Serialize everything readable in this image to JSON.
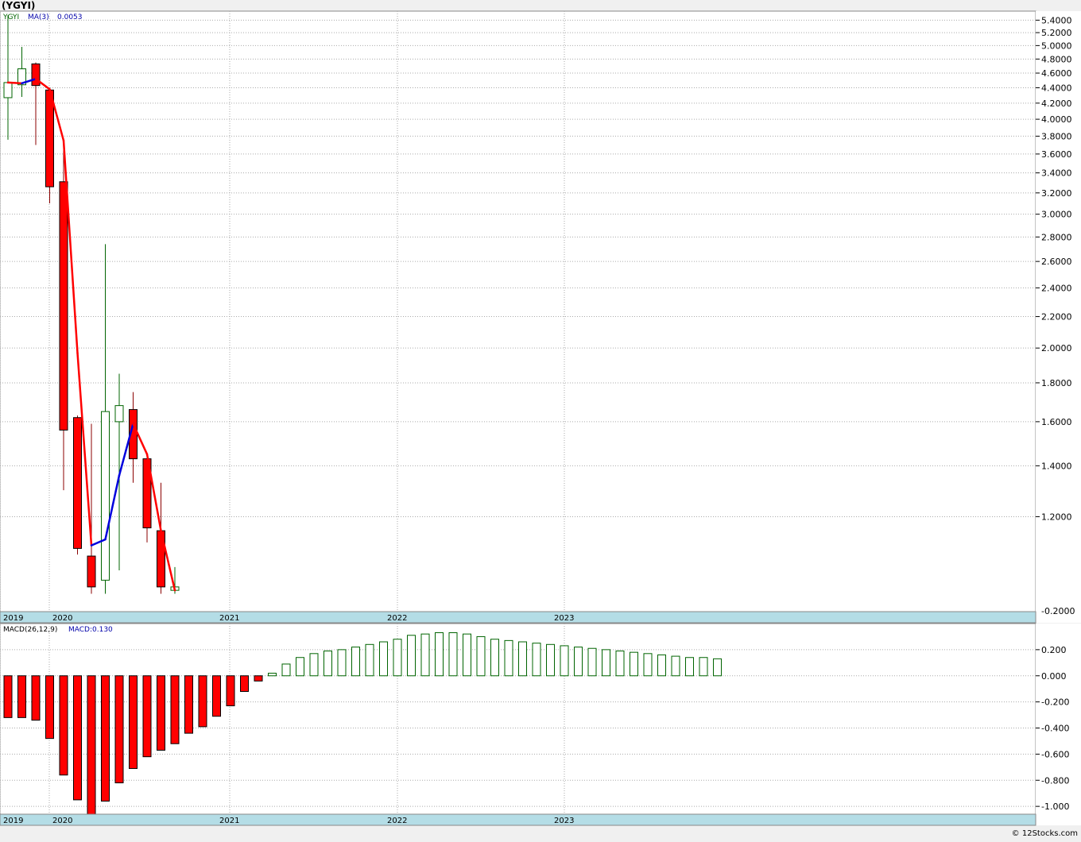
{
  "chart_data": [
    {
      "type": "candlestick",
      "title": "(YGYI)",
      "legend": {
        "symbol": "YGYI",
        "ma_label": "MA(3)",
        "last_value": "0.0053",
        "placement": "top-left"
      },
      "scale": "log",
      "ylim": [
        0.9,
        5.55
      ],
      "y_ticks": [
        "5.4000",
        "5.2000",
        "5.0000",
        "4.8000",
        "4.6000",
        "4.4000",
        "4.2000",
        "4.0000",
        "3.8000",
        "3.6000",
        "3.4000",
        "3.2000",
        "3.0000",
        "2.8000",
        "2.6000",
        "2.4000",
        "2.2000",
        "2.0000",
        "1.8000",
        "1.6000",
        "1.4000",
        "1.2000"
      ],
      "y_tick_values": [
        5.4,
        5.2,
        5.0,
        4.8,
        4.6,
        4.4,
        4.2,
        4.0,
        3.8,
        3.6,
        3.4,
        3.2,
        3.0,
        2.8,
        2.6,
        2.4,
        2.2,
        2.0,
        1.8,
        1.6,
        1.4,
        1.2
      ],
      "bottom_tick_label": "-0.2000",
      "x_labels": [
        "2019",
        "2020",
        "2021",
        "2022",
        "2023"
      ],
      "grid": true,
      "colors": {
        "up": "#006400",
        "down": "#ff0000",
        "ma_up": "#0000dd",
        "ma_down": "#ff0000",
        "axis_band": "#b4dde6"
      },
      "candles": [
        {
          "period": "2019-09",
          "open": 4.27,
          "high": 5.48,
          "low": 3.76,
          "close": 4.47
        },
        {
          "period": "2019-10",
          "open": 4.44,
          "high": 4.98,
          "low": 4.28,
          "close": 4.66
        },
        {
          "period": "2019-11",
          "open": 4.73,
          "high": 4.75,
          "low": 3.7,
          "close": 4.43
        },
        {
          "period": "2019-12",
          "open": 4.37,
          "high": 4.4,
          "low": 3.1,
          "close": 3.26
        },
        {
          "period": "2020-01",
          "open": 3.31,
          "high": 3.65,
          "low": 1.3,
          "close": 1.56
        },
        {
          "period": "2020-02",
          "open": 1.62,
          "high": 1.63,
          "low": 1.07,
          "close": 1.09
        },
        {
          "period": "2020-03",
          "open": 1.065,
          "high": 1.59,
          "low": 0.95,
          "close": 0.97
        },
        {
          "period": "2020-04",
          "open": 0.99,
          "high": 2.74,
          "low": 0.95,
          "close": 1.65
        },
        {
          "period": "2020-05",
          "open": 1.6,
          "high": 1.85,
          "low": 1.02,
          "close": 1.68
        },
        {
          "period": "2020-06",
          "open": 1.66,
          "high": 1.75,
          "low": 1.33,
          "close": 1.43
        },
        {
          "period": "2020-07",
          "open": 1.43,
          "high": 1.45,
          "low": 1.11,
          "close": 1.16
        },
        {
          "period": "2020-08",
          "open": 1.15,
          "high": 1.33,
          "low": 0.95,
          "close": 0.97
        },
        {
          "period": "2020-09",
          "open": 0.96,
          "high": 1.03,
          "low": 0.95,
          "close": 0.97
        }
      ],
      "ma3": [
        {
          "period": "2019-09",
          "value": 4.47
        },
        {
          "period": "2019-10",
          "value": 4.46
        },
        {
          "period": "2019-11",
          "value": 4.52
        },
        {
          "period": "2019-12",
          "value": 4.38
        },
        {
          "period": "2020-01",
          "value": 3.75
        },
        {
          "period": "2020-02",
          "value": 1.97
        },
        {
          "period": "2020-03",
          "value": 1.1
        },
        {
          "period": "2020-04",
          "value": 1.12
        },
        {
          "period": "2020-05",
          "value": 1.36
        },
        {
          "period": "2020-06",
          "value": 1.59
        },
        {
          "period": "2020-07",
          "value": 1.45
        },
        {
          "period": "2020-08",
          "value": 1.15
        },
        {
          "period": "2020-09",
          "value": 0.96
        }
      ]
    },
    {
      "type": "bar",
      "title": "MACD(26,12,9)",
      "legend": {
        "label": "MACD:0.130",
        "placement": "top-left"
      },
      "ylim": [
        -1.06,
        0.4
      ],
      "y_ticks": [
        "0.200",
        "0.000",
        "-0.200",
        "-0.400",
        "-0.600",
        "-0.800",
        "-1.000"
      ],
      "y_tick_values": [
        0.2,
        0.0,
        -0.2,
        -0.4,
        -0.6,
        -0.8,
        -1.0
      ],
      "x_labels": [
        "2019",
        "2020",
        "2021",
        "2022",
        "2023"
      ],
      "grid": true,
      "colors": {
        "positive": "#006400",
        "negative": "#ff0000"
      },
      "values": [
        -0.32,
        -0.32,
        -0.34,
        -0.48,
        -0.76,
        -0.95,
        -1.06,
        -0.96,
        -0.82,
        -0.71,
        -0.62,
        -0.57,
        -0.52,
        -0.44,
        -0.39,
        -0.31,
        -0.23,
        -0.12,
        -0.04,
        0.02,
        0.09,
        0.14,
        0.17,
        0.19,
        0.2,
        0.22,
        0.24,
        0.26,
        0.28,
        0.31,
        0.32,
        0.33,
        0.33,
        0.32,
        0.3,
        0.28,
        0.27,
        0.26,
        0.25,
        0.24,
        0.23,
        0.22,
        0.21,
        0.2,
        0.19,
        0.18,
        0.17,
        0.16,
        0.15,
        0.14,
        0.14,
        0.13
      ]
    }
  ],
  "footer": {
    "copyright": "© 12Stocks.com"
  }
}
